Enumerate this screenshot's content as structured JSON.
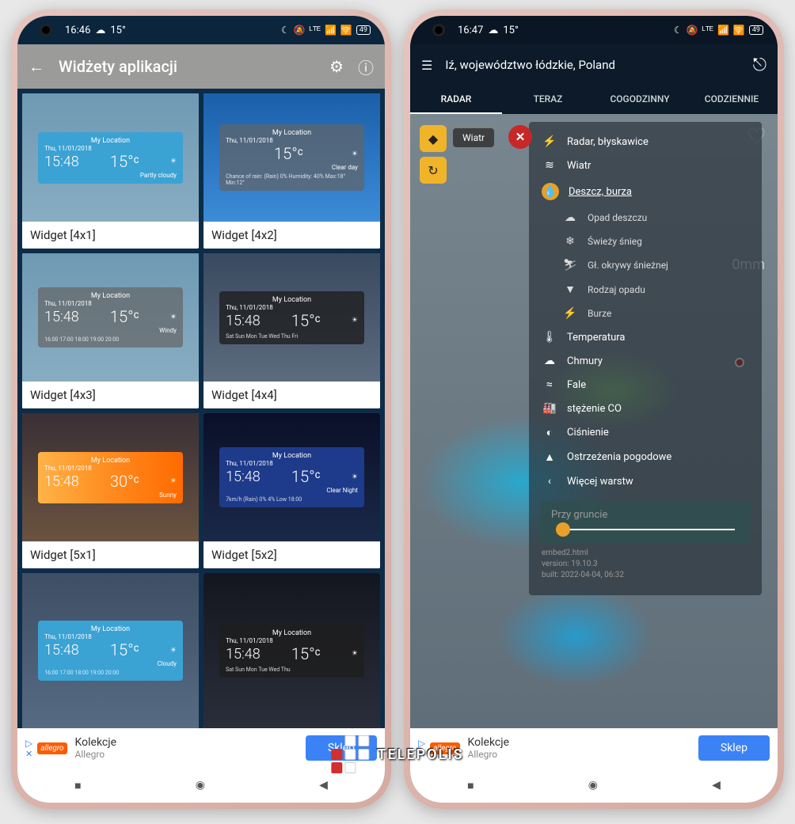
{
  "status": {
    "time_left": "16:46",
    "time_right": "16:47",
    "cloud": "☁",
    "temp": "15°",
    "battery": "49"
  },
  "left": {
    "appbar_title": "Widżety aplikacji",
    "widgets": [
      {
        "label": "Widget [4x1]",
        "bg": "bg-snow",
        "pv": "skyblue",
        "loc": "My Location",
        "date": "Thu, 11/01/2018",
        "time": "15:48",
        "temp": "15°ᶜ",
        "cond": "Partly cloudy"
      },
      {
        "label": "Widget [4x2]",
        "bg": "bg-sky",
        "pv": "grayp",
        "loc": "My Location",
        "date": "Thu, 11/01/2018",
        "time": "",
        "temp": "15°ᶜ",
        "cond": "Clear day",
        "extra": "Chance of rain: (Rain) 0%  Humidity: 40%  Max:18° Min:12°"
      },
      {
        "label": "Widget [4x3]",
        "bg": "bg-snow",
        "pv": "grayp",
        "loc": "My Location",
        "date": "Thu, 11/01/2018",
        "time": "15:48",
        "temp": "15°ᶜ",
        "cond": "Windy",
        "extra": "16:00 17:00 18:00 19:00 20:00"
      },
      {
        "label": "Widget [4x4]",
        "bg": "bg-fog",
        "pv": "darkp",
        "loc": "My Location",
        "date": "Thu, 11/01/2018",
        "time": "15:48",
        "temp": "15°ᶜ",
        "cond": "",
        "extra": "Sat Sun Mon Tue Wed Thu Fri"
      },
      {
        "label": "Widget [5x1]",
        "bg": "bg-sun",
        "pv": "orange",
        "loc": "My Location",
        "date": "Thu, 11/01/2018",
        "time": "15:48",
        "temp": "30°ᶜ",
        "cond": "Sunny"
      },
      {
        "label": "Widget [5x2]",
        "bg": "bg-night",
        "pv": "bluex",
        "loc": "My Location",
        "date": "Thu, 11/01/2018",
        "time": "15:48",
        "temp": "15°ᶜ",
        "cond": "Clear Night",
        "extra": "7km/h (Rain) 0% 4% Low 18:00"
      },
      {
        "label": "",
        "bg": "bg-cloud",
        "pv": "skyblue",
        "loc": "My Location",
        "date": "Thu, 11/01/2018",
        "time": "15:48",
        "temp": "15°ᶜ",
        "cond": "Cloudy",
        "extra": "16:00 17:00 18:00 19:00 20:00"
      },
      {
        "label": "",
        "bg": "bg-moon",
        "pv": "darkp",
        "loc": "My Location",
        "date": "Thu, 11/01/2018",
        "time": "15:48",
        "temp": "15°ᶜ",
        "cond": "",
        "extra": "Sat Sun Mon Tue Wed Thu"
      }
    ]
  },
  "ad": {
    "brand": "allegro",
    "title": "Kolekcje",
    "subtitle": "Allegro",
    "cta": "Sklep"
  },
  "right": {
    "location": "Iź, województwo łódzkie, Poland",
    "tabs": [
      "RADAR",
      "TERAZ",
      "COGODZINNY",
      "CODZIENNIE"
    ],
    "active_tab": 0,
    "chip": "Wiatr",
    "mm": "0mm",
    "layers": [
      {
        "icon": "⚡",
        "label": "Radar, błyskawice"
      },
      {
        "icon": "≋",
        "label": "Wiatr"
      },
      {
        "icon": "💧",
        "label": "Deszcz, burza",
        "selected": true
      },
      {
        "icon": "☁",
        "label": "Opad deszczu",
        "sub": true
      },
      {
        "icon": "❄",
        "label": "Świeży śnieg",
        "sub": true
      },
      {
        "icon": "⛷",
        "label": "Gł. okrywy śnieżnej",
        "sub": true
      },
      {
        "icon": "▼",
        "label": "Rodzaj opadu",
        "sub": true
      },
      {
        "icon": "⚡",
        "label": "Burze",
        "sub": true
      },
      {
        "icon": "🌡",
        "label": "Temperatura"
      },
      {
        "icon": "☁",
        "label": "Chmury"
      },
      {
        "icon": "≈",
        "label": "Fale"
      },
      {
        "icon": "🏭",
        "label": "stężenie CO"
      },
      {
        "icon": "◐",
        "label": "Ciśnienie"
      },
      {
        "icon": "▲",
        "label": "Ostrzeżenia pogodowe"
      },
      {
        "icon": "‹",
        "label": "Więcej warstw"
      }
    ],
    "slider_label": "Przy gruncie",
    "version": {
      "a": "embed2.html",
      "b": "version: 19.10.3",
      "c": "built: 2022-04-04, 06:32"
    }
  },
  "watermark": "TELEPOLIS"
}
